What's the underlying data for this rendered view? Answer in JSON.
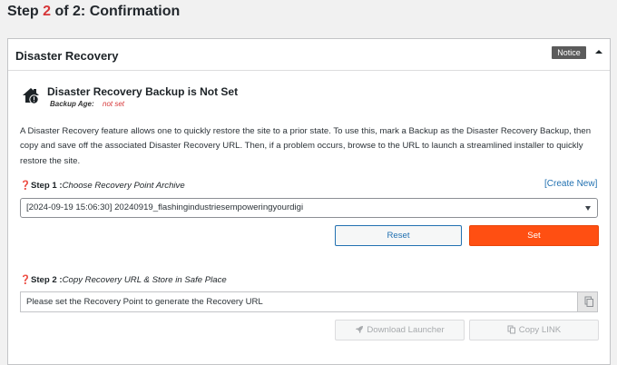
{
  "header": {
    "step_prefix": "Step ",
    "step_num": "2",
    "step_suffix": " of 2: Confirmation"
  },
  "panel": {
    "title": "Disaster Recovery",
    "badge": "Notice"
  },
  "status": {
    "title": "Disaster Recovery Backup is Not Set",
    "age_label": "Backup Age:",
    "age_value": "not set"
  },
  "description": "A Disaster Recovery feature allows one to quickly restore the site to a prior state. To use this, mark a Backup as the Disaster Recovery Backup, then copy and save off the associated Disaster Recovery URL. Then, if a problem occurs, browse to the URL to launch a streamlined installer to quickly restore the site.",
  "step1": {
    "icon": "❓",
    "label": "Step 1 :",
    "hint": "Choose Recovery Point Archive",
    "create_new": "[Create New]",
    "selected": "[2024-09-19 15:06:30] 20240919_flashingindustriesempoweringyourdigi",
    "reset_label": "Reset",
    "set_label": "Set"
  },
  "step2": {
    "icon": "❓",
    "label": "Step 2 :",
    "hint": "Copy Recovery URL & Store in Safe Place",
    "url_text": "Please set the Recovery Point to generate the Recovery URL",
    "download_label": "Download Launcher",
    "copy_label": "Copy LINK"
  },
  "colors": {
    "accent": "#2271b1",
    "set_button": "#ff4f12",
    "alert_text": "#d63638"
  }
}
